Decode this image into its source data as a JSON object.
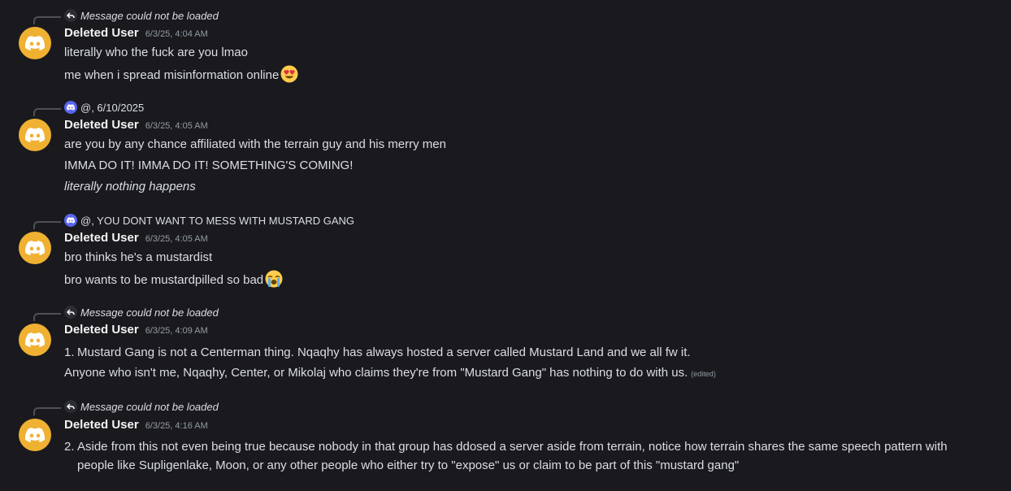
{
  "messages": [
    {
      "reply": {
        "type": "unloaded",
        "text": "Message could not be loaded"
      },
      "username": "Deleted User",
      "timestamp": "6/3/25, 4:04 AM",
      "lines": [
        {
          "text": "literally who the fuck are you lmao"
        },
        {
          "text": "me when i spread misinformation online",
          "emoji": "heart-eyes-emoji"
        }
      ]
    },
    {
      "reply": {
        "type": "user",
        "text": "@, 6/10/2025"
      },
      "username": "Deleted User",
      "timestamp": "6/3/25, 4:05 AM",
      "lines": [
        {
          "text": "are you by any chance affiliated with the terrain guy and his merry men"
        },
        {
          "text": "IMMA DO IT! IMMA DO IT! SOMETHING'S COMING!"
        },
        {
          "text": "literally nothing happens",
          "italic": true
        }
      ]
    },
    {
      "reply": {
        "type": "user",
        "text": "@, YOU DONT WANT TO MESS WITH MUSTARD GANG"
      },
      "username": "Deleted User",
      "timestamp": "6/3/25, 4:05 AM",
      "lines": [
        {
          "text": "bro thinks he's a mustardist"
        },
        {
          "text": "bro wants to be mustardpilled so bad",
          "emoji": "loudly-crying-emoji"
        }
      ]
    },
    {
      "reply": {
        "type": "unloaded",
        "text": "Message could not be loaded"
      },
      "username": "Deleted User",
      "timestamp": "6/3/25, 4:09 AM",
      "list_item": {
        "num": "1.",
        "text": "Mustard Gang is not a Centerman thing. Nqaqhy has always hosted a server called Mustard Land and we all fw it."
      },
      "lines": [
        {
          "text": "Anyone who isn't me, Nqaqhy, Center, or Mikolaj who claims they're from \"Mustard Gang\" has nothing to do with us.",
          "edited": "(edited)"
        }
      ]
    },
    {
      "reply": {
        "type": "unloaded",
        "text": "Message could not be loaded"
      },
      "username": "Deleted User",
      "timestamp": "6/3/25, 4:16 AM",
      "list_item": {
        "num": "2.",
        "text": "Aside from this not even being true because nobody in that group has ddosed a server aside from terrain, notice how terrain shares the same speech pattern with people like Supligenlake, Moon, or any other people who either try to \"expose\" us or claim to be part of this \"mustard gang\""
      }
    }
  ],
  "colors": {
    "background": "#1a1a1e",
    "avatar": "#f0b132",
    "reply_avatar": "#5865f2",
    "username": "#f2f3f5",
    "text": "#dbdee1",
    "timestamp": "#949ba4"
  }
}
